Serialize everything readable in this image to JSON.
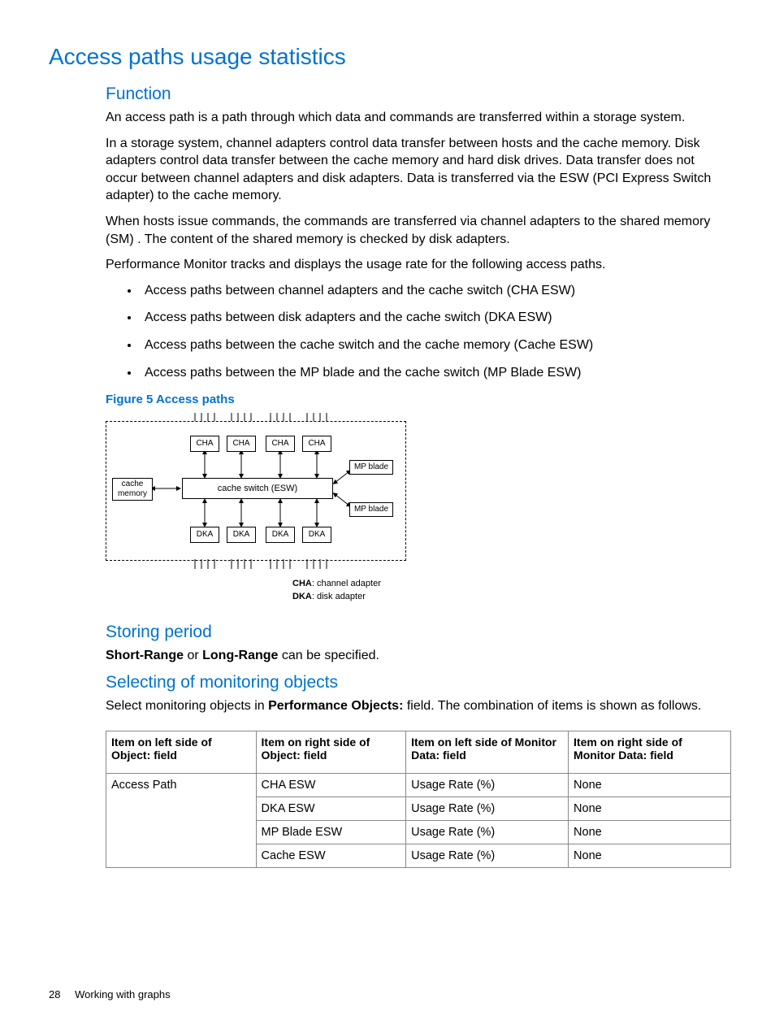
{
  "title": "Access paths usage statistics",
  "section1": {
    "heading": "Function",
    "p1": "An access path is a path through which data and commands are transferred within a storage system.",
    "p2": "In a storage system, channel adapters control data transfer between hosts and the cache memory. Disk adapters control data transfer between the cache memory and hard disk drives. Data transfer does not occur between channel adapters and disk adapters. Data is transferred via the ESW (PCI Express Switch adapter) to the cache memory.",
    "p3": "When hosts issue commands, the commands are transferred via channel adapters to the shared memory (SM) . The content of the shared memory is checked by disk adapters.",
    "p4": "Performance Monitor tracks and displays the usage rate for the following access paths.",
    "bullets": [
      "Access paths between channel adapters and the cache switch (CHA ESW)",
      "Access paths between disk adapters and the cache switch (DKA ESW)",
      "Access paths between the cache switch and the cache memory (Cache ESW)",
      "Access paths between the MP blade and the cache switch (MP Blade ESW)"
    ]
  },
  "figure": {
    "caption": "Figure 5 Access paths",
    "labels": {
      "cha": "CHA",
      "dka": "DKA",
      "cache_memory_l1": "cache",
      "cache_memory_l2": "memory",
      "cache_switch": "cache switch (ESW)",
      "mp_blade": "MP blade",
      "legend_cha_b": "CHA",
      "legend_cha": ": channel adapter",
      "legend_dka_b": "DKA",
      "legend_dka": ": disk adapter"
    }
  },
  "section2": {
    "heading": "Storing period",
    "p1_before": "",
    "bold1": "Short-Range",
    "mid": " or ",
    "bold2": "Long-Range",
    "after": " can be specified."
  },
  "section3": {
    "heading": "Selecting of monitoring objects",
    "p_before": "Select monitoring objects in ",
    "p_bold": "Performance Objects:",
    "p_after": " field. The combination of items is shown as follows."
  },
  "table": {
    "headers": [
      "Item on left side of Object: field",
      "Item on right side of Object: field",
      "Item on left side of Monitor Data: field",
      "Item on right side of Monitor Data: field"
    ],
    "rows": [
      {
        "c1": "Access Path",
        "c2": "CHA ESW",
        "c3": "Usage Rate (%)",
        "c4": "None"
      },
      {
        "c1": "",
        "c2": "DKA ESW",
        "c3": "Usage Rate (%)",
        "c4": "None"
      },
      {
        "c1": "",
        "c2": "MP Blade ESW",
        "c3": "Usage Rate (%)",
        "c4": "None"
      },
      {
        "c1": "",
        "c2": "Cache ESW",
        "c3": "Usage Rate (%)",
        "c4": "None"
      }
    ]
  },
  "footer": {
    "page": "28",
    "chapter": "Working with graphs"
  }
}
